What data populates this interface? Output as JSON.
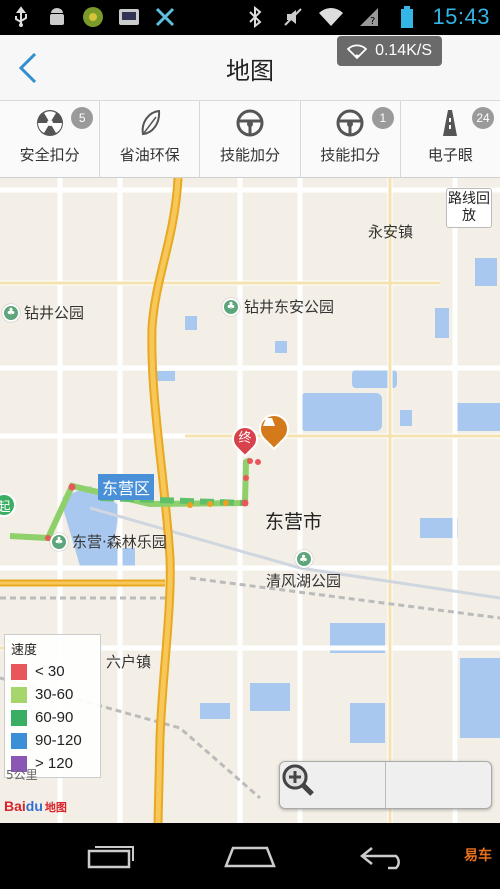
{
  "status_bar": {
    "time": "15:43",
    "left_icons": [
      "usb-icon",
      "android-icon",
      "app-icon",
      "inbox-icon",
      "tools-icon"
    ],
    "right_icons": [
      "bluetooth-icon",
      "mute-icon",
      "wifi-icon",
      "signal-icon",
      "battery-icon"
    ]
  },
  "header": {
    "title": "地图",
    "network_speed": "0.14K/S"
  },
  "tabs": [
    {
      "label": "安全扣分",
      "icon": "radiation-icon",
      "badge": "5"
    },
    {
      "label": "省油环保",
      "icon": "leaf-icon",
      "badge": ""
    },
    {
      "label": "技能加分",
      "icon": "steering-wheel-icon",
      "badge": ""
    },
    {
      "label": "技能扣分",
      "icon": "steering-wheel-icon",
      "badge": "1"
    },
    {
      "label": "电子眼",
      "icon": "road-camera-icon",
      "badge": "24"
    }
  ],
  "map": {
    "replay_button": "路线回放",
    "places": {
      "yongan": "永安镇",
      "zuanjing_park": "钻井公园",
      "zuanjing_dongan_park": "钻井东安公园",
      "dongying_district": "东营区",
      "dongying_city": "东营市",
      "forest_park": "东营·森林乐园",
      "qingfenghu_park": "清风湖公园",
      "liuhu_town": "六户镇"
    },
    "start_marker": "起",
    "end_marker": "终",
    "legend": {
      "title": "速度",
      "items": [
        {
          "label": "< 30",
          "color": "#e8585b"
        },
        {
          "label": "30-60",
          "color": "#a6d66b"
        },
        {
          "label": "60-90",
          "color": "#3aae63"
        },
        {
          "label": "90-120",
          "color": "#3a8fd6"
        },
        {
          "label": "> 120",
          "color": "#8a57b5"
        }
      ]
    },
    "scale_text": "5公里",
    "logo_text": "Bai地图"
  },
  "navbar": {
    "watermark": "易车"
  }
}
